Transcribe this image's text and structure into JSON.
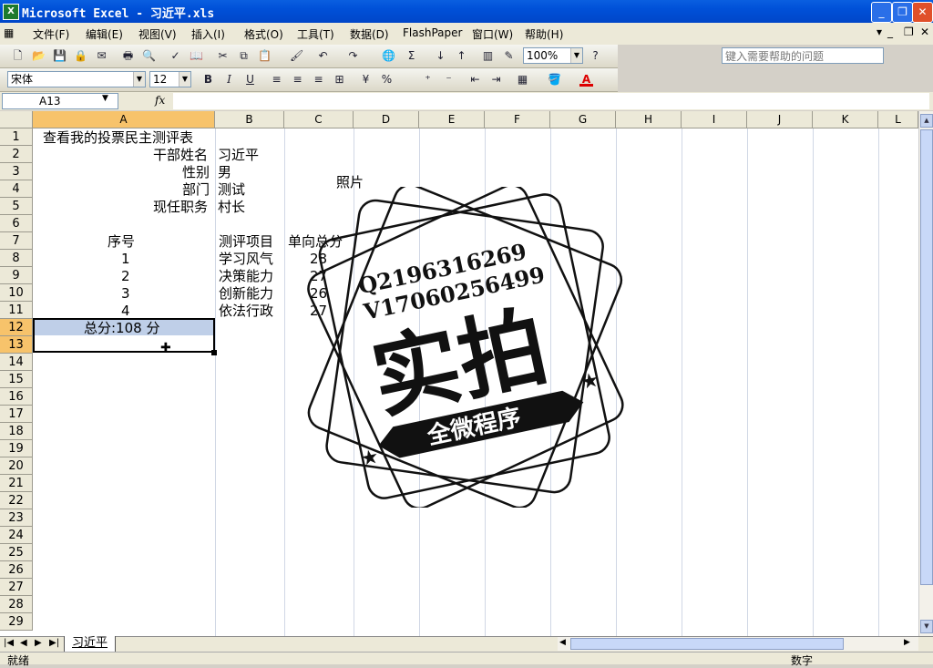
{
  "window": {
    "title": "Microsoft Excel - 习近平.xls",
    "app_icon": "excel-icon",
    "controls": [
      "minimize-icon",
      "restore-icon",
      "close-icon"
    ]
  },
  "menu": {
    "items": [
      "文件(F)",
      "编辑(E)",
      "视图(V)",
      "插入(I)",
      "格式(O)",
      "工具(T)",
      "数据(D)",
      "FlashPaper",
      "窗口(W)",
      "帮助(H)"
    ],
    "help_placeholder": "键入需要帮助的问题"
  },
  "toolbar": {
    "zoom": "100%",
    "font": "宋体",
    "font_size": "12",
    "bold": "B",
    "italic": "I",
    "underline": "U",
    "percent": "%",
    "sum": "Σ"
  },
  "formula_bar": {
    "name_box": "A13",
    "fx": "fx",
    "value": ""
  },
  "columns": [
    "A",
    "B",
    "C",
    "D",
    "E",
    "F",
    "G",
    "H",
    "I",
    "J",
    "K",
    "L"
  ],
  "rows": [
    "1",
    "2",
    "3",
    "4",
    "5",
    "6",
    "7",
    "8",
    "9",
    "10",
    "11",
    "12",
    "13",
    "14",
    "15",
    "16",
    "17",
    "18",
    "19",
    "20",
    "21",
    "22",
    "23",
    "24",
    "25",
    "26",
    "27",
    "28",
    "29"
  ],
  "cells": {
    "A1": "查看我的投票民主测评表",
    "A2": "干部姓名",
    "B2": "习近平",
    "A3": "性别",
    "B3": "男",
    "C3": "照片",
    "A4": "部门",
    "B4": "测试",
    "A5": "现任职务",
    "B5": "村长",
    "A7": "序号",
    "B7": "测评项目",
    "C7": "单向总分",
    "A8": "1",
    "B8": "学习风气",
    "C8": "28",
    "A9": "2",
    "B9": "决策能力",
    "C9": "27",
    "A10": "3",
    "B10": "创新能力",
    "C10": "26",
    "A11": "4",
    "B11": "依法行政",
    "C11": "27",
    "A12": "总分:108 分"
  },
  "watermark": {
    "line1": "Q2196316269",
    "line2": "V17060256499",
    "big": "实拍",
    "banner": "全微程序"
  },
  "sheet_tab": "习近平",
  "status": {
    "left": "就绪",
    "right": "数字"
  },
  "colors": {
    "title_bar": "#0050d8",
    "selected_header": "#f7c36b",
    "selection_fill": "#bfcfe8"
  }
}
